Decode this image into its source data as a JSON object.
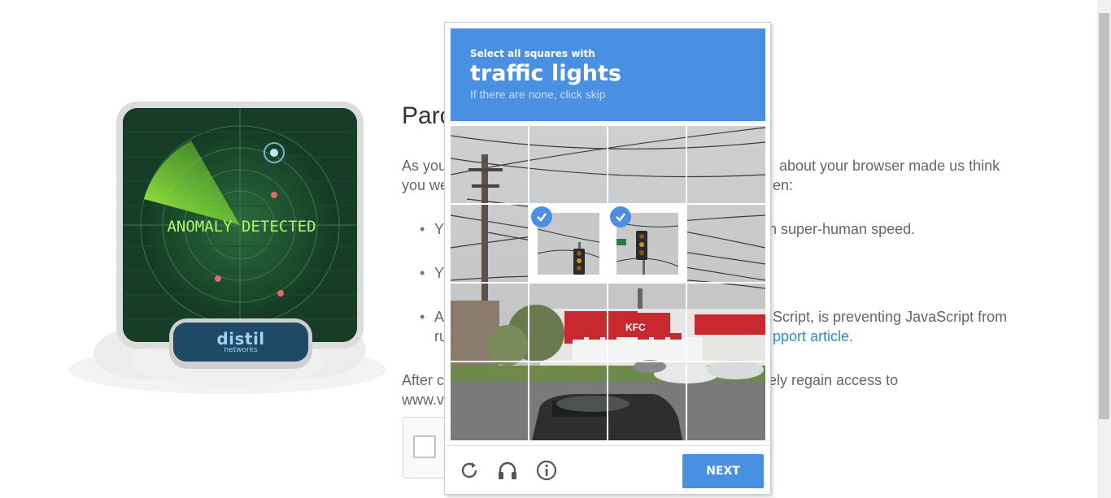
{
  "page": {
    "title_visible": "Parc",
    "para1_line1_left": "As you",
    "para1_line1_right": "about your browser made us think",
    "para1_line2_left": "you we",
    "para1_line2_right": "en:",
    "bullet1_left": "Y",
    "bullet1_right": "h super-human speed.",
    "bullet2_left": "Y",
    "bullet3_left": "A",
    "bullet3_right": "Script, is preventing JavaScript from",
    "bullet3_line2_left": "ru",
    "bullet3_link": "pport article",
    "bullet3_period": ".",
    "para2_line1_left": "After c",
    "para2_line1_right": "ely regain access to",
    "para2_line2_left": "www.v",
    "radar_text": "ANOMALY DETECTED",
    "badge_logo": "distil",
    "badge_sub": "networks"
  },
  "challenge": {
    "instruction_small": "Select all squares with",
    "instruction_target": "traffic lights",
    "instruction_hint": "If there are none, click skip",
    "next_label": "NEXT",
    "selected_tiles": [
      5,
      6
    ]
  },
  "colors": {
    "accent": "#4a90e2",
    "radar_green": "#7ee03a",
    "link": "#2b8bd9"
  },
  "icons": [
    "reload-icon",
    "audio-icon",
    "info-icon",
    "checkmark-icon",
    "distil-logo-icon"
  ]
}
